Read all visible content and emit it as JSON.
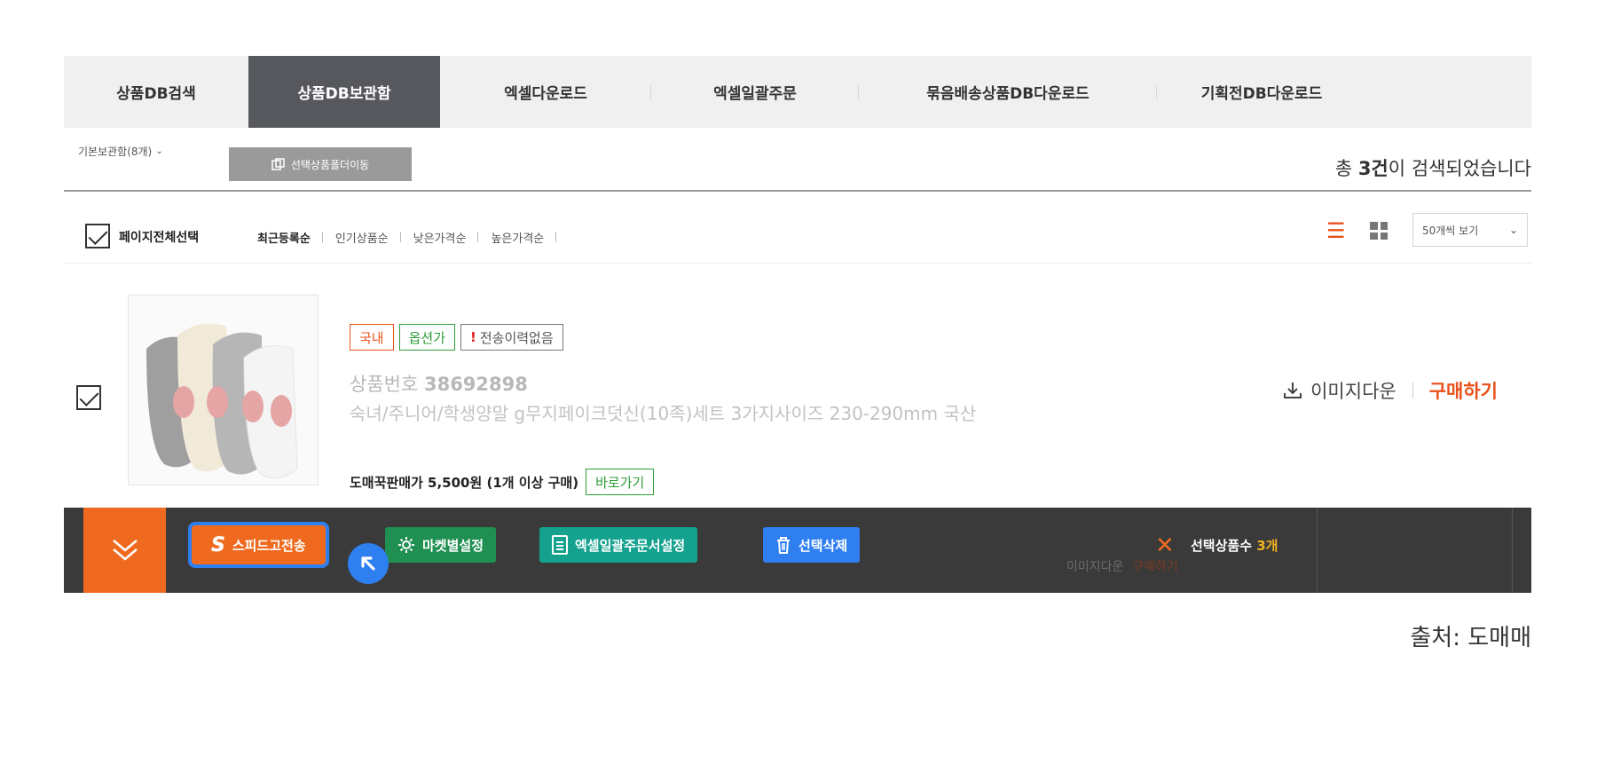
{
  "tabs": [
    {
      "label": "상품DB검색",
      "active": false
    },
    {
      "label": "상품DB보관함",
      "active": true
    },
    {
      "label": "엑셀다운로드",
      "active": false
    },
    {
      "label": "엑셀일괄주문",
      "active": false
    },
    {
      "label": "묶음배송상품DB다운로드",
      "active": false
    },
    {
      "label": "기획전DB다운로드",
      "active": false
    }
  ],
  "toolbar": {
    "folder_select": "기본보관함(8개)",
    "move_button": "선택상품폴더이동",
    "result_prefix": "총 ",
    "result_count": "3건",
    "result_suffix": "이 검색되었습니다"
  },
  "sort": {
    "select_all_label": "페이지전체선택",
    "options": [
      "최근등록순",
      "인기상품순",
      "낮은가격순",
      "높은가격순"
    ],
    "active_index": 0,
    "per_page": "50개씩 보기"
  },
  "product": {
    "badges": {
      "domestic": "국내",
      "option": "옵션가",
      "history": "전송이력없음"
    },
    "number_label": "상품번호 ",
    "number": "38692898",
    "name": "숙녀/주니어/학생양말 g무지페이크덧신(10족)세트 3가지사이즈 230-290mm 국산",
    "price_text": "도매꾹판매가 5,500원 (1개 이상 구매)",
    "go_button": "바로가기",
    "image_download": "이미지다운",
    "buy": "구매하기"
  },
  "actionbar": {
    "speed_button": "스피드고전송",
    "market_button": "마켓별설정",
    "excel_button": "엑셀일괄주문서설정",
    "delete_button": "선택삭제",
    "selected_label": "선택상품수",
    "selected_count": "3개",
    "ghost_image_download": "이미지다운",
    "ghost_buy": "구매하기"
  },
  "source": "출처: 도매매",
  "colors": {
    "accent": "#ef6a1e",
    "tab_active": "#56585d",
    "bar": "#3a3a3a",
    "market": "#1f8f52",
    "excel": "#14a28f",
    "delete": "#2f7ff0",
    "option_green": "#2e9d3a"
  }
}
